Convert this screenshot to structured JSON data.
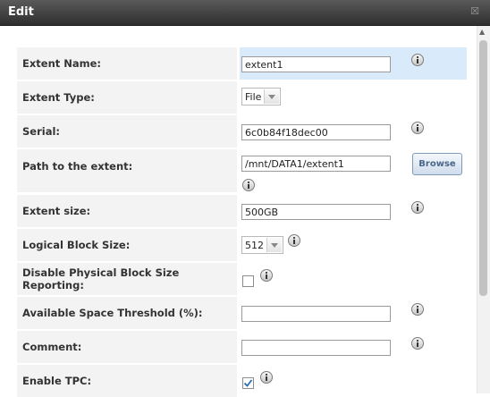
{
  "dialog": {
    "title": "Edit",
    "close_symbol": "☒"
  },
  "form": {
    "extent_name": {
      "label": "Extent Name:",
      "value": "extent1"
    },
    "extent_type": {
      "label": "Extent Type:",
      "value": "File"
    },
    "serial": {
      "label": "Serial:",
      "value": "6c0b84f18dec00"
    },
    "path": {
      "label": "Path to the extent:",
      "value": "/mnt/DATA1/extent1",
      "browse_label": "Browse"
    },
    "extent_size": {
      "label": "Extent size:",
      "value": "500GB"
    },
    "logical_block_size": {
      "label": "Logical Block Size:",
      "value": "512"
    },
    "disable_pbsr": {
      "label": "Disable Physical Block Size Reporting:",
      "checked": false
    },
    "avail_threshold": {
      "label": "Available Space Threshold (%):",
      "value": ""
    },
    "comment": {
      "label": "Comment:",
      "value": ""
    },
    "enable_tpc": {
      "label": "Enable TPC:",
      "checked": true
    }
  },
  "icons": {
    "info": "info-icon",
    "dropdown": "chevron-down-icon",
    "close": "close-icon"
  }
}
